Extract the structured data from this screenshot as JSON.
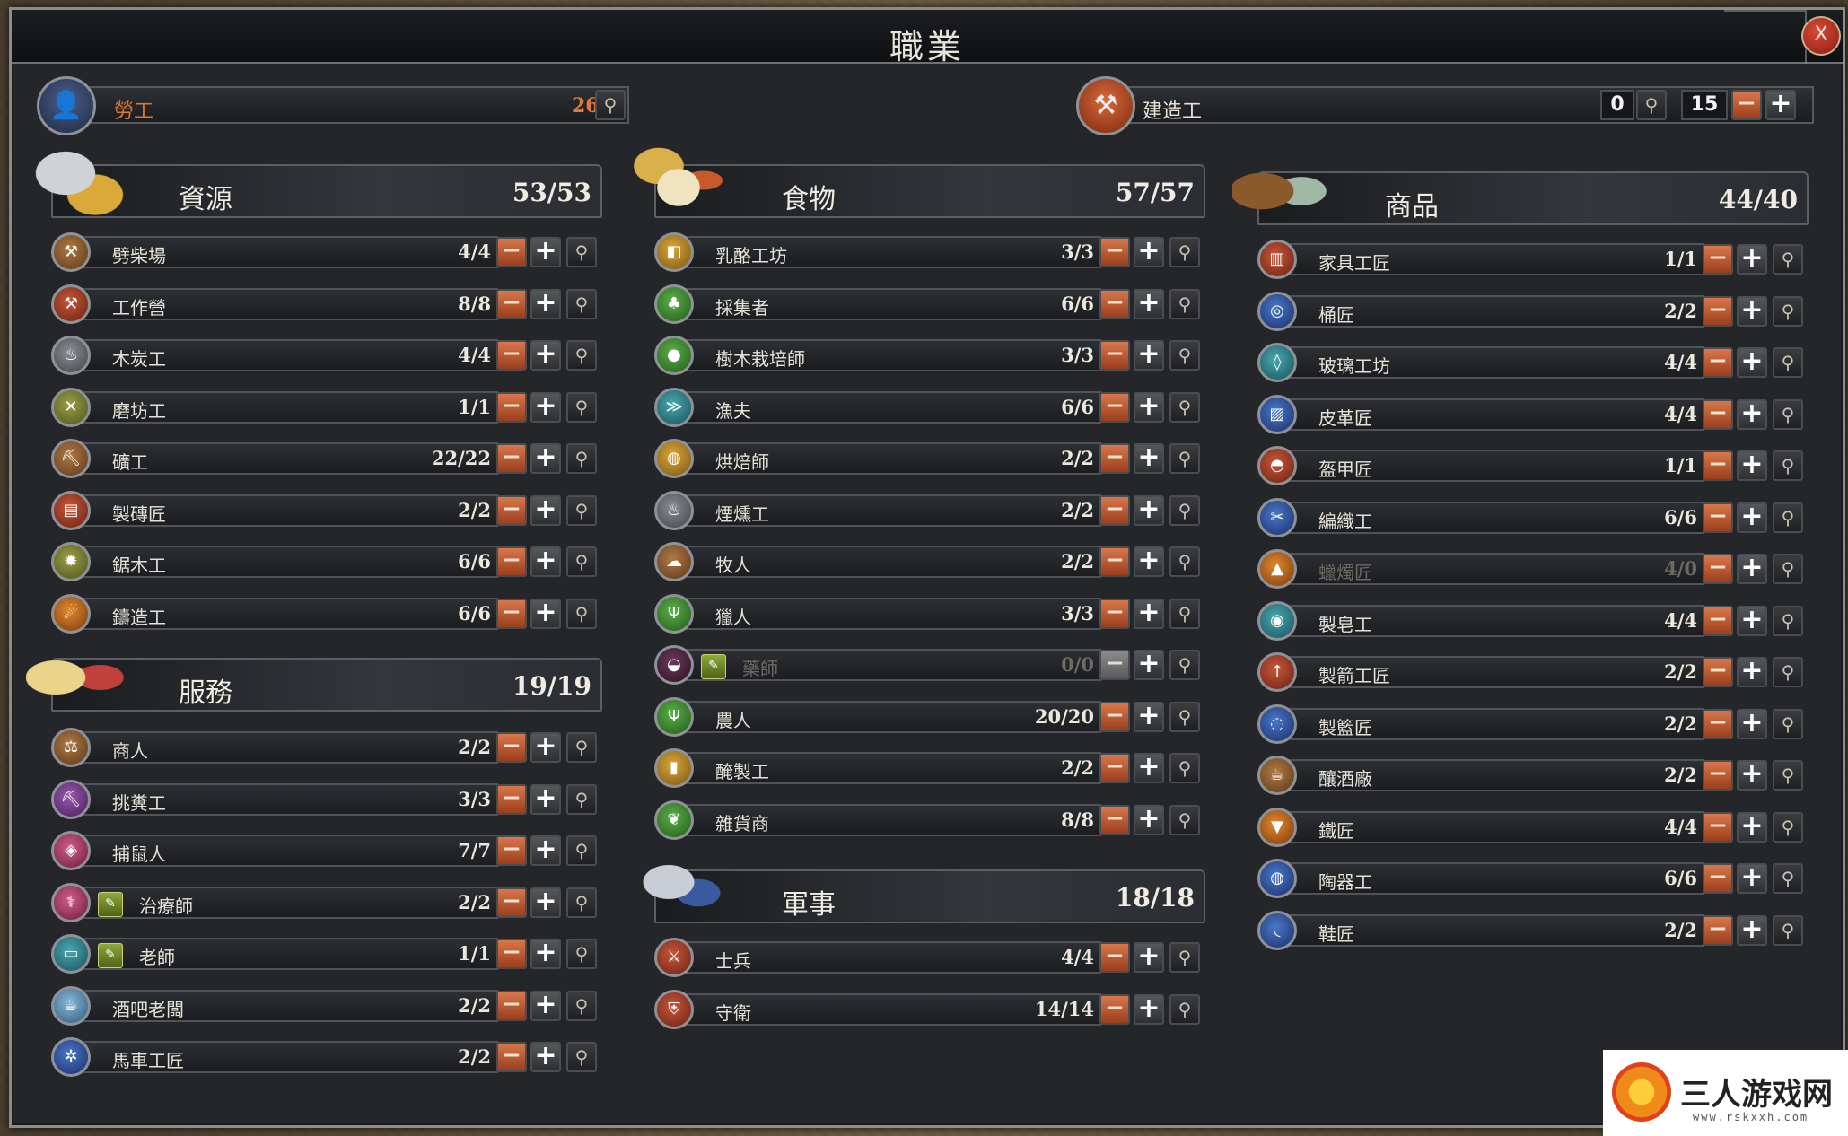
{
  "window": {
    "title": "職業",
    "close_label": "X"
  },
  "worker": {
    "label": "勞工",
    "count": "26"
  },
  "builder": {
    "label": "建造工",
    "assigned": "0",
    "target": "15"
  },
  "colors": {
    "minus": "#c0582a",
    "accent_orange": "#e07a3a"
  },
  "sections": {
    "resources": {
      "name": "資源",
      "count": "53/53",
      "rows": [
        {
          "label": "劈柴場",
          "count": "4/4",
          "icon": "axe-icon"
        },
        {
          "label": "工作營",
          "count": "8/8",
          "icon": "tools-icon"
        },
        {
          "label": "木炭工",
          "count": "4/4",
          "icon": "coal-icon"
        },
        {
          "label": "磨坊工",
          "count": "1/1",
          "icon": "mill-icon"
        },
        {
          "label": "礦工",
          "count": "22/22",
          "icon": "pickaxe-icon"
        },
        {
          "label": "製磚匠",
          "count": "2/2",
          "icon": "brick-icon"
        },
        {
          "label": "鋸木工",
          "count": "6/6",
          "icon": "saw-icon"
        },
        {
          "label": "鑄造工",
          "count": "6/6",
          "icon": "forge-icon"
        }
      ]
    },
    "services": {
      "name": "服務",
      "count": "19/19",
      "rows": [
        {
          "label": "商人",
          "count": "2/2",
          "icon": "scales-icon"
        },
        {
          "label": "挑糞工",
          "count": "3/3",
          "icon": "shovel-icon"
        },
        {
          "label": "捕鼠人",
          "count": "7/7",
          "icon": "rat-icon"
        },
        {
          "label": "治療師",
          "count": "2/2",
          "icon": "caduceus-icon",
          "book": true
        },
        {
          "label": "老師",
          "count": "1/1",
          "icon": "book-icon",
          "book": true
        },
        {
          "label": "酒吧老闆",
          "count": "2/2",
          "icon": "tavern-icon"
        },
        {
          "label": "馬車工匠",
          "count": "2/2",
          "icon": "wheel-icon"
        }
      ]
    },
    "food": {
      "name": "食物",
      "count": "57/57",
      "rows": [
        {
          "label": "乳酪工坊",
          "count": "3/3",
          "icon": "cheese-icon"
        },
        {
          "label": "採集者",
          "count": "6/6",
          "icon": "mushroom-icon"
        },
        {
          "label": "樹木栽培師",
          "count": "3/3",
          "icon": "apple-icon"
        },
        {
          "label": "漁夫",
          "count": "6/6",
          "icon": "fish-icon"
        },
        {
          "label": "烘焙師",
          "count": "2/2",
          "icon": "bread-icon"
        },
        {
          "label": "煙燻工",
          "count": "2/2",
          "icon": "smoke-icon"
        },
        {
          "label": "牧人",
          "count": "2/2",
          "icon": "sheep-icon"
        },
        {
          "label": "獵人",
          "count": "3/3",
          "icon": "deer-icon"
        },
        {
          "label": "藥師",
          "count": "0/0",
          "icon": "mortar-icon",
          "book": true,
          "dim": true
        },
        {
          "label": "農人",
          "count": "20/20",
          "icon": "pitchfork-icon"
        },
        {
          "label": "醃製工",
          "count": "2/2",
          "icon": "jar-icon"
        },
        {
          "label": "雜貨商",
          "count": "8/8",
          "icon": "basket-icon"
        }
      ]
    },
    "military": {
      "name": "軍事",
      "count": "18/18",
      "rows": [
        {
          "label": "士兵",
          "count": "4/4",
          "icon": "swords-icon"
        },
        {
          "label": "守衛",
          "count": "14/14",
          "icon": "shield-icon"
        }
      ]
    },
    "goods": {
      "name": "商品",
      "count": "44/40",
      "rows": [
        {
          "label": "家具工匠",
          "count": "1/1",
          "icon": "chair-icon"
        },
        {
          "label": "桶匠",
          "count": "2/2",
          "icon": "barrel-icon"
        },
        {
          "label": "玻璃工坊",
          "count": "4/4",
          "icon": "bottle-icon"
        },
        {
          "label": "皮革匠",
          "count": "4/4",
          "icon": "leather-icon"
        },
        {
          "label": "盔甲匠",
          "count": "1/1",
          "icon": "helmet-icon"
        },
        {
          "label": "編織工",
          "count": "6/6",
          "icon": "needle-icon"
        },
        {
          "label": "蠟燭匠",
          "count": "4/0",
          "icon": "candle-icon",
          "dim": true
        },
        {
          "label": "製皂工",
          "count": "4/4",
          "icon": "soap-icon"
        },
        {
          "label": "製箭工匠",
          "count": "2/2",
          "icon": "arrow-icon"
        },
        {
          "label": "製籃匠",
          "count": "2/2",
          "icon": "weave-icon"
        },
        {
          "label": "釀酒廠",
          "count": "2/2",
          "icon": "beer-icon"
        },
        {
          "label": "鐵匠",
          "count": "4/4",
          "icon": "anvil-icon"
        },
        {
          "label": "陶器工",
          "count": "6/6",
          "icon": "pot-icon"
        },
        {
          "label": "鞋匠",
          "count": "2/2",
          "icon": "shoe-icon"
        }
      ]
    }
  },
  "watermark": {
    "text": "三人游戏网",
    "sub": "www.rskxxh.com"
  }
}
